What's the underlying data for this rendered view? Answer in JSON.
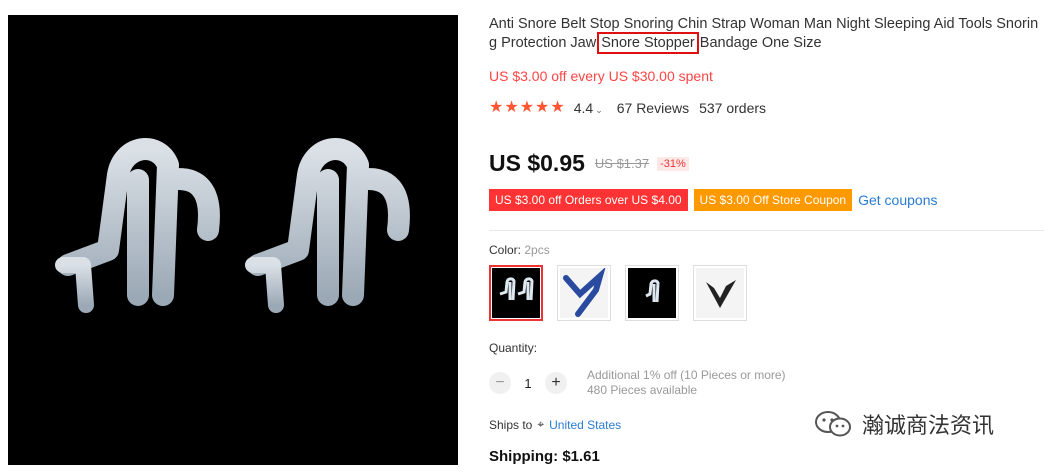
{
  "product": {
    "title_before": "Anti Snore Belt Stop Snoring Chin Strap Woman Man Night Sleeping Aid Tools Snoring Protection Jaw",
    "title_highlight": "Snore Stopper",
    "title_after": "Bandage One Size",
    "promo": "US $3.00 off every US $30.00 spent",
    "rating": "4.4",
    "reviews": "67 Reviews",
    "orders": "537 orders",
    "price": "US $0.95",
    "old_price": "US $1.37",
    "discount": "-31%",
    "coupon_1": "US $3.00 off Orders over US $4.00",
    "coupon_2": "US $3.00 Off Store Coupon",
    "get_coupons": "Get coupons",
    "color_label": "Color:",
    "color_value": "2pcs",
    "quantity_label": "Quantity:",
    "quantity_minus": "−",
    "quantity_value": "1",
    "quantity_plus": "+",
    "quantity_note": "Additional 1% off (10 Pieces or more)",
    "pieces_available": "480 Pieces available",
    "ships_to_label": "Ships to",
    "ships_to_country": "United States",
    "shipping": "Shipping: $1.61"
  },
  "watermark": {
    "text": "瀚诚商法资讯"
  },
  "colors": {
    "price_red": "#ff4444",
    "star": "#ff5533",
    "link": "#2a7bd3",
    "coupon_red": "#ff3333",
    "coupon_orange": "#ff9900"
  }
}
